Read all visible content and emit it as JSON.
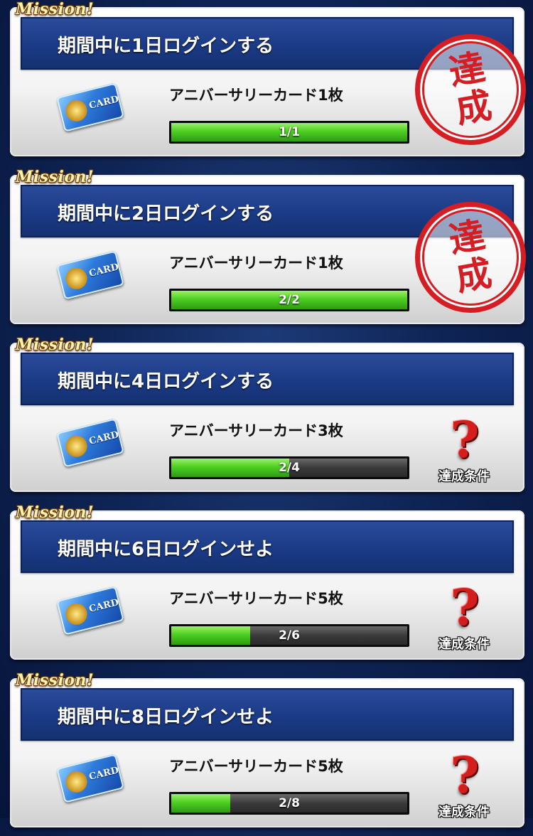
{
  "missions": [
    {
      "tag": "Mission!",
      "title": "期間中に1日ログインする",
      "reward": "アニバーサリーカード1枚",
      "progress_text": "1/1",
      "progress": 1.0,
      "status_stamp": "達成",
      "status_char1": "達",
      "status_char2": "成"
    },
    {
      "tag": "Mission!",
      "title": "期間中に2日ログインする",
      "reward": "アニバーサリーカード1枚",
      "progress_text": "2/2",
      "progress": 1.0,
      "status_stamp": "達成",
      "status_char1": "達",
      "status_char2": "成"
    },
    {
      "tag": "Mission!",
      "title": "期間中に4日ログインする",
      "reward": "アニバーサリーカード3枚",
      "progress_text": "2/4",
      "progress": 0.5,
      "condition_label": "達成条件"
    },
    {
      "tag": "Mission!",
      "title": "期間中に6日ログインせよ",
      "reward": "アニバーサリーカード5枚",
      "progress_text": "2/6",
      "progress": 0.3333,
      "condition_label": "達成条件"
    },
    {
      "tag": "Mission!",
      "title": "期間中に8日ログインせよ",
      "reward": "アニバーサリーカード5枚",
      "progress_text": "2/8",
      "progress": 0.25,
      "condition_label": "達成条件"
    }
  ],
  "reward_icon_text": "CARD",
  "colors": {
    "title_bar": "#1b3a86",
    "progress_fill": "#4dcf22",
    "stamp": "#d51e24",
    "question": "#d41d1d"
  }
}
